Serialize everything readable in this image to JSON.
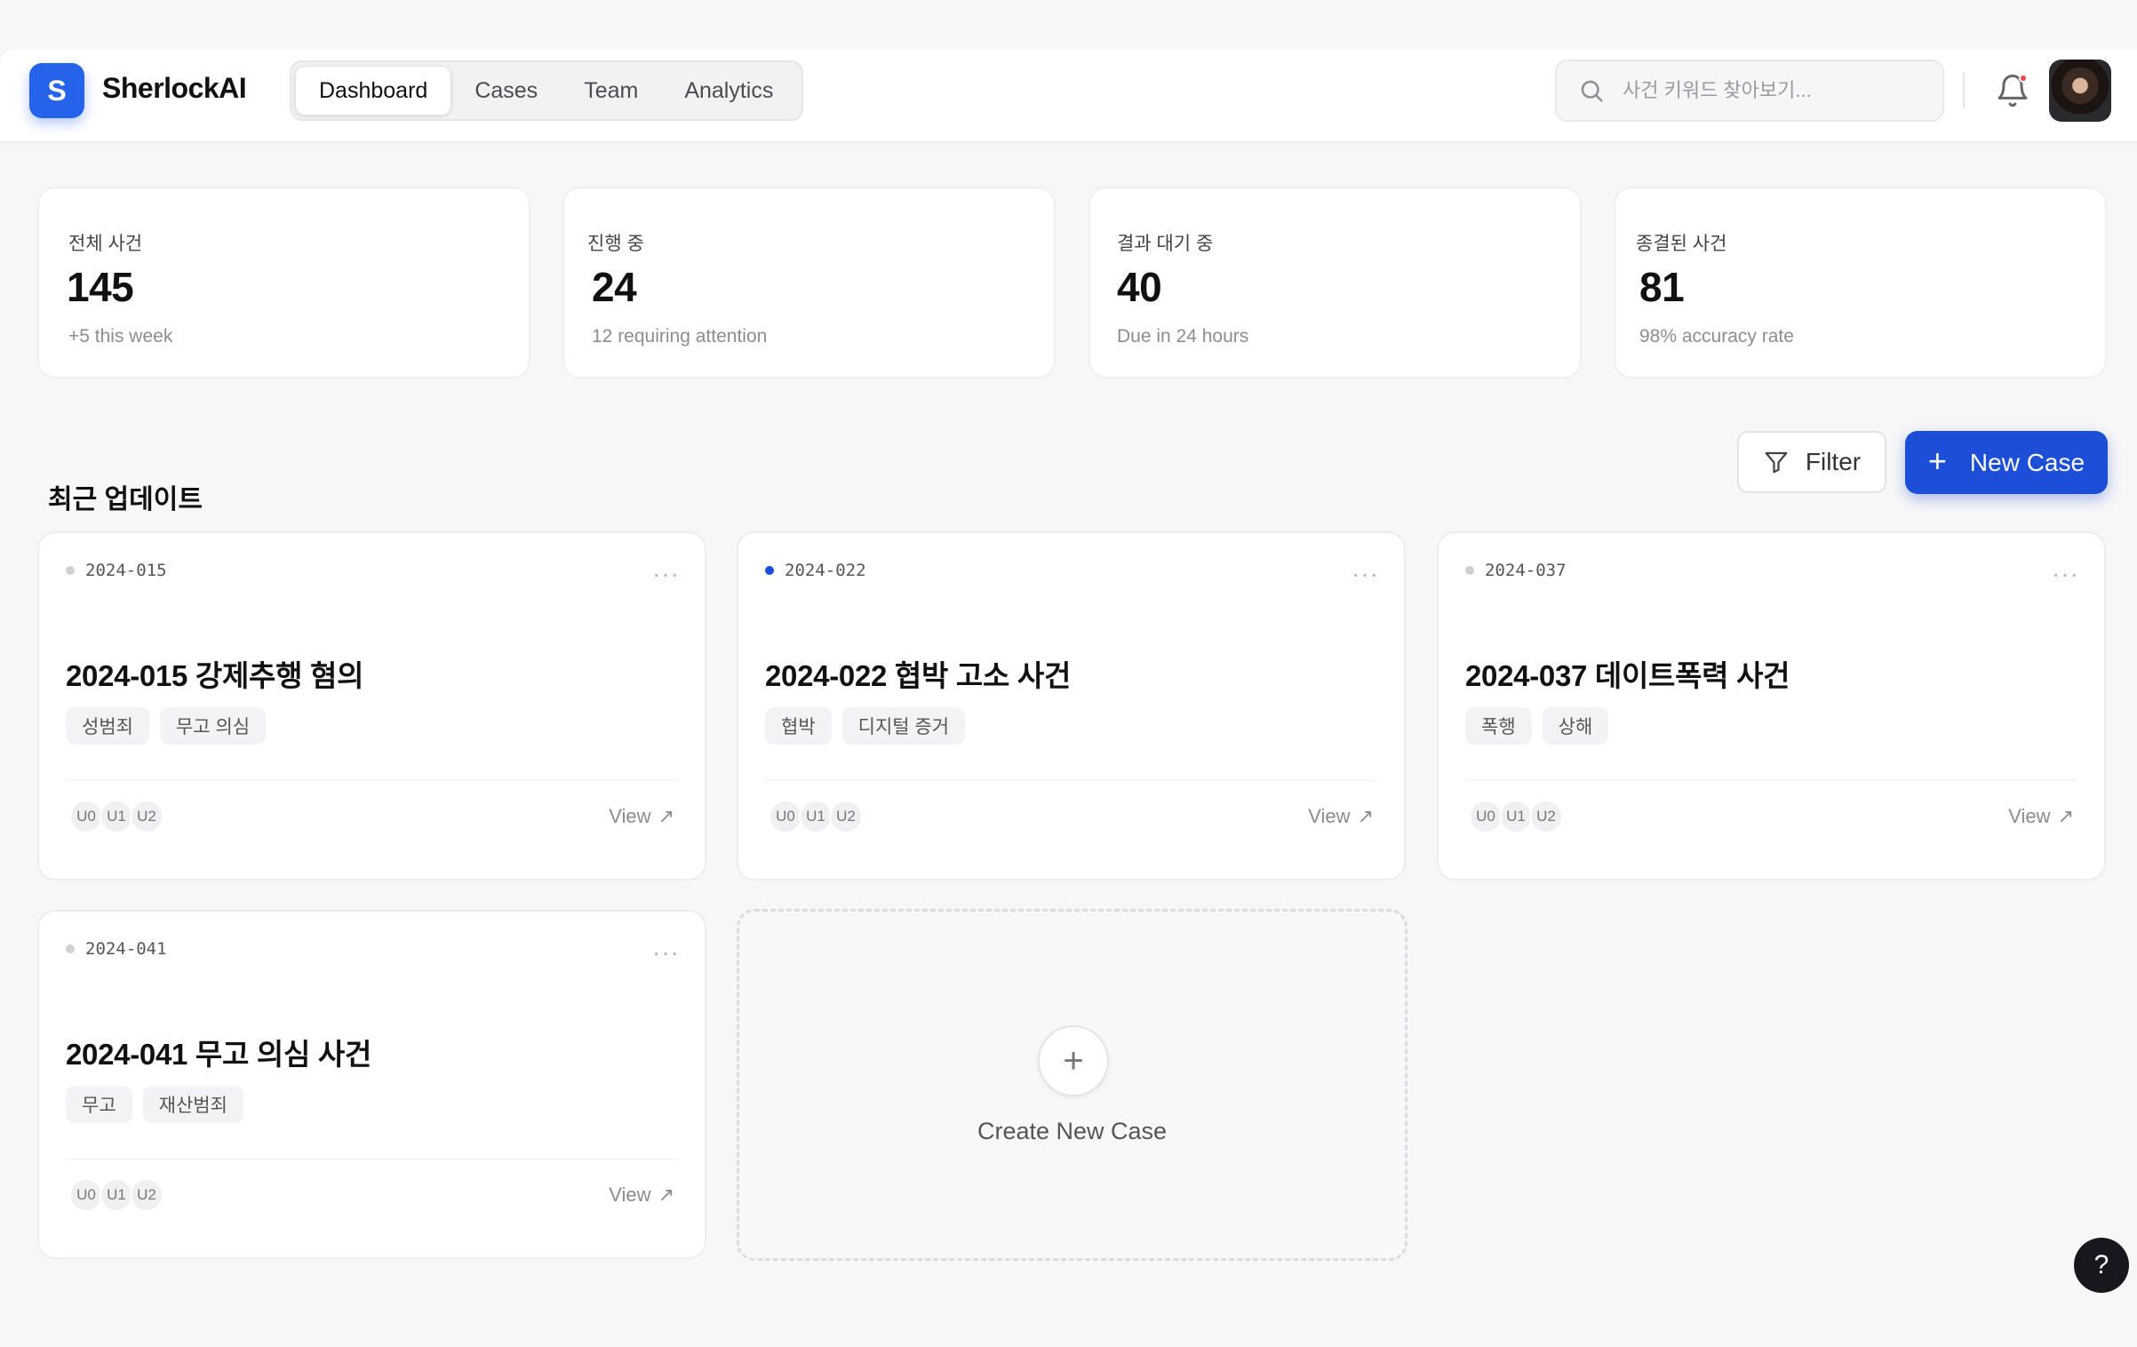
{
  "header": {
    "logo_letter": "S",
    "brand": "SherlockAI",
    "tabs": [
      {
        "label": "Dashboard"
      },
      {
        "label": "Cases"
      },
      {
        "label": "Team"
      },
      {
        "label": "Analytics"
      }
    ],
    "active_tab": "Dashboard",
    "search_placeholder": "사건 키워드 찾아보기..."
  },
  "stats": [
    {
      "label": "전체 사건",
      "value": "145",
      "sub": "+5 this week"
    },
    {
      "label": "진행 중",
      "value": "24",
      "sub": "12 requiring attention"
    },
    {
      "label": "결과 대기 중",
      "value": "40",
      "sub": "Due in 24 hours"
    },
    {
      "label": "종결된 사건",
      "value": "81",
      "sub": "98% accuracy rate"
    }
  ],
  "section": {
    "title": "최근 업데이트",
    "filter_label": "Filter",
    "new_case_label": "New Case"
  },
  "cases": [
    {
      "id": "2024-015",
      "active": false,
      "title": "2024-015 강제추행 혐의",
      "tags": [
        "성범죄",
        "무고 의심"
      ],
      "users": [
        "U0",
        "U1",
        "U2"
      ],
      "view_label": "View"
    },
    {
      "id": "2024-022",
      "active": true,
      "title": "2024-022 협박 고소 사건",
      "tags": [
        "협박",
        "디지털 증거"
      ],
      "users": [
        "U0",
        "U1",
        "U2"
      ],
      "view_label": "View"
    },
    {
      "id": "2024-037",
      "active": false,
      "title": "2024-037 데이트폭력 사건",
      "tags": [
        "폭행",
        "상해"
      ],
      "users": [
        "U0",
        "U1",
        "U2"
      ],
      "view_label": "View"
    },
    {
      "id": "2024-041",
      "active": false,
      "title": "2024-041 무고 의심 사건",
      "tags": [
        "무고",
        "재산범죄"
      ],
      "users": [
        "U0",
        "U1",
        "U2"
      ],
      "view_label": "View"
    }
  ],
  "create_card": {
    "plus": "+",
    "label": "Create New Case"
  },
  "more_glyph": "···",
  "view_arrow": "↗",
  "help_label": "?",
  "colors": {
    "accent": "#1d4ed8",
    "logo": "#2563eb",
    "notification": "#ef4444"
  },
  "icons": [
    "search-icon",
    "bell-icon",
    "filter-icon",
    "plus-icon",
    "more-icon",
    "arrow-up-right-icon",
    "help-icon"
  ]
}
